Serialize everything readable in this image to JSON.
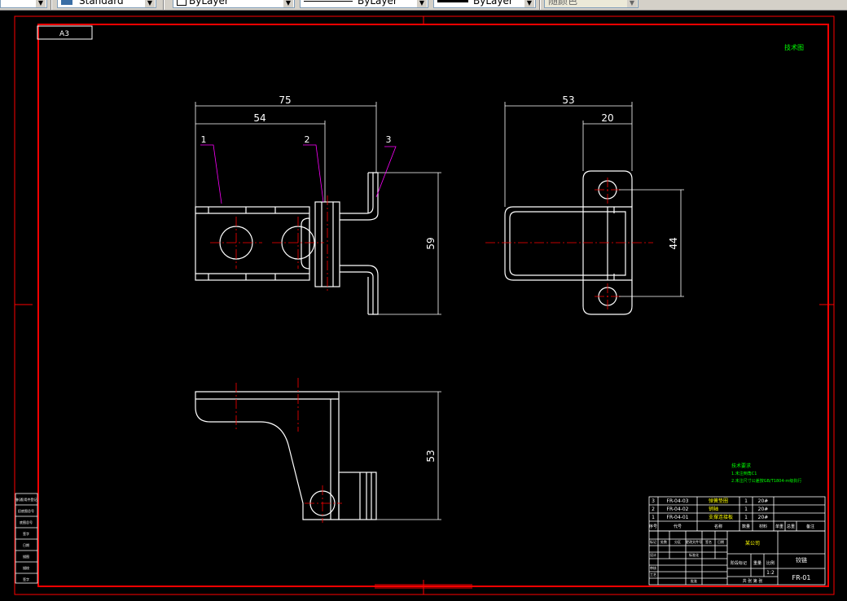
{
  "toolbar": {
    "textstyle_value": "Standard",
    "layer_color_value": "ByLayer",
    "linetype_value": "ByLayer",
    "lineweight_value": "ByLayer",
    "plotstyle_value": "随颜色"
  },
  "drawing": {
    "sheet_size": "A3",
    "top_right_note": "技术图",
    "dims": {
      "front_total_width": "75",
      "front_inner_width": "54",
      "front_height": "59",
      "side_total_width": "53",
      "side_inner_width": "20",
      "side_height": "44",
      "bottom_height": "53"
    },
    "balloons": [
      "1",
      "2",
      "3"
    ],
    "tech_requirements": {
      "title": "技术要求",
      "line1": "1.未注倒角C1",
      "line2": "2.未注尺寸公差按GB/T1804-m级执行"
    },
    "bom_rows": [
      {
        "no": "3",
        "code": "FR-04-03",
        "name": "弹簧垫圈",
        "qty": "1",
        "material": "20#"
      },
      {
        "no": "2",
        "code": "FR-04-02",
        "name": "销轴",
        "qty": "1",
        "material": "20#"
      },
      {
        "no": "1",
        "code": "FR-04-01",
        "name": "支撑连接板",
        "qty": "1",
        "material": "20#"
      }
    ],
    "bom_header": [
      "序号",
      "代号",
      "名称",
      "数量",
      "材料",
      "单重",
      "总重",
      "备注"
    ],
    "title_block": {
      "part_name": "铰链",
      "drawing_no": "FR-01",
      "company": "某公司",
      "scale": "1:2",
      "label_stage": "阶段标记",
      "label_weight": "重量",
      "label_scale": "比例",
      "label_sheets": "共 张 第 张",
      "label_design": "设计",
      "label_check": "审核",
      "label_process": "工艺",
      "label_date": "日期",
      "label_mark": "标记",
      "label_qty": "处数",
      "label_zone": "分区",
      "label_change": "更改文件号",
      "label_sign": "签名",
      "label_std": "标准化",
      "label_approve": "批准"
    },
    "side_strip": [
      "借(通)用件登记",
      "旧底图总号",
      "底图总号",
      "签字",
      "日期",
      "描图",
      "描校",
      "签字"
    ]
  }
}
